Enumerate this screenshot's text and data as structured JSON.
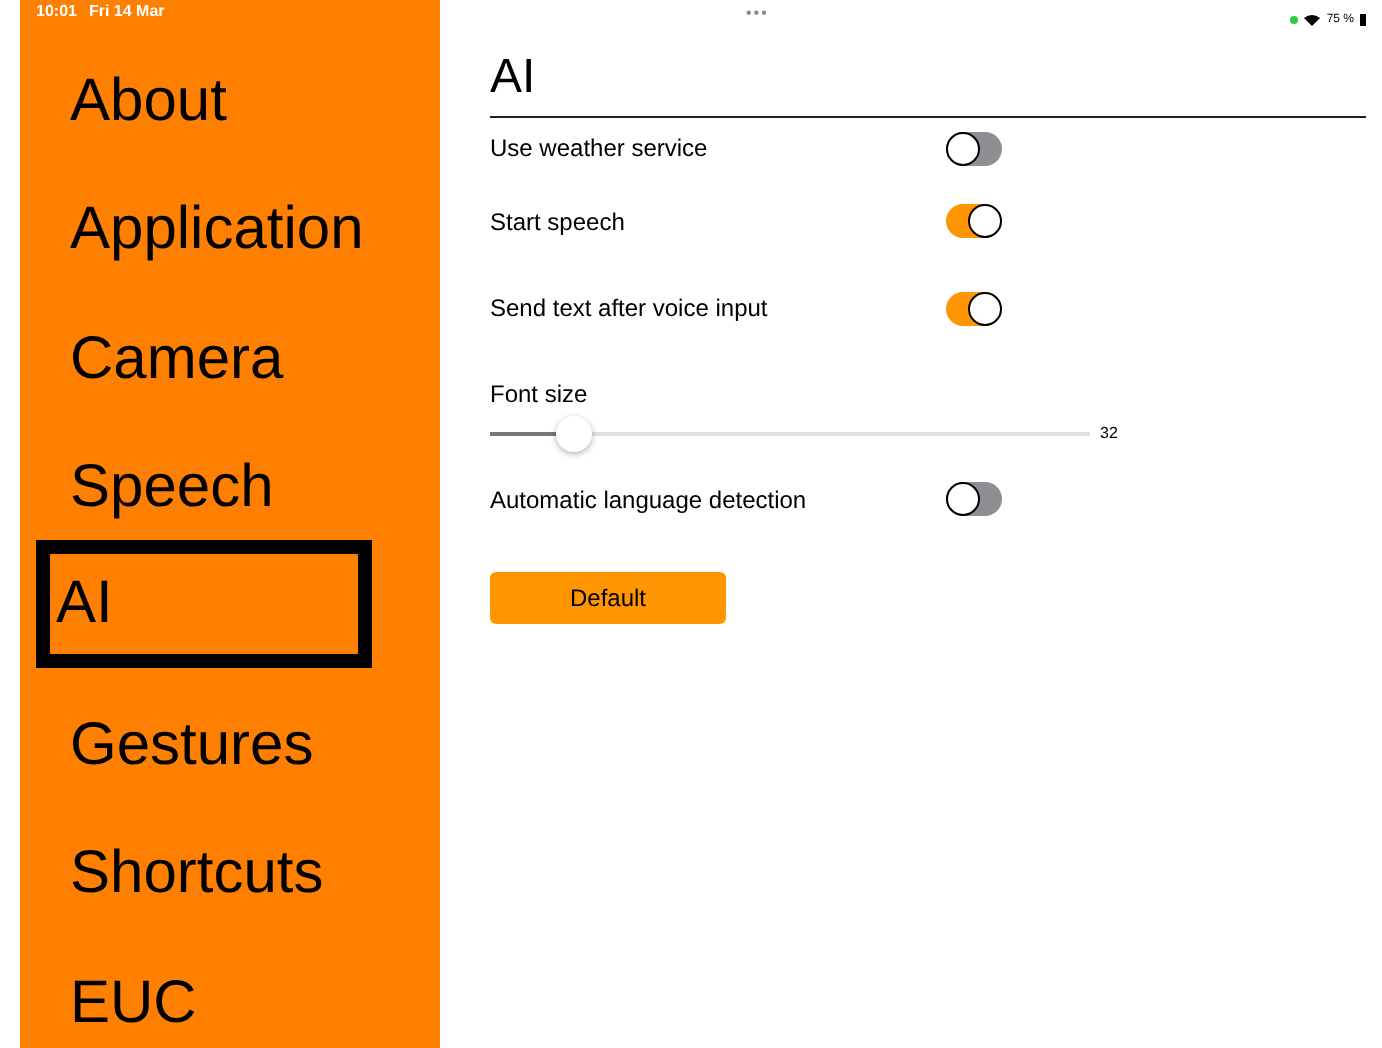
{
  "status_bar": {
    "time": "10:01",
    "date": "Fri 14 Mar",
    "dots": "•••",
    "battery": "75 %"
  },
  "sidebar": {
    "items": [
      {
        "label": "About",
        "selected": false
      },
      {
        "label": "Application",
        "selected": false
      },
      {
        "label": "Camera",
        "selected": false
      },
      {
        "label": "Speech",
        "selected": false
      },
      {
        "label": "AI",
        "selected": true
      },
      {
        "label": "Gestures",
        "selected": false
      },
      {
        "label": "Shortcuts",
        "selected": false
      },
      {
        "label": "EUC",
        "selected": false
      }
    ]
  },
  "page": {
    "title": "AI",
    "settings": [
      {
        "kind": "toggle",
        "label": "Use weather service",
        "on": false
      },
      {
        "kind": "toggle",
        "label": "Start speech",
        "on": true
      },
      {
        "kind": "toggle",
        "label": "Send text after voice input",
        "on": true
      },
      {
        "kind": "slider",
        "label": "Font size",
        "level": 0.13,
        "reading": "32"
      },
      {
        "kind": "toggle",
        "label": "Automatic language detection",
        "on": false
      }
    ],
    "button": "Default"
  }
}
